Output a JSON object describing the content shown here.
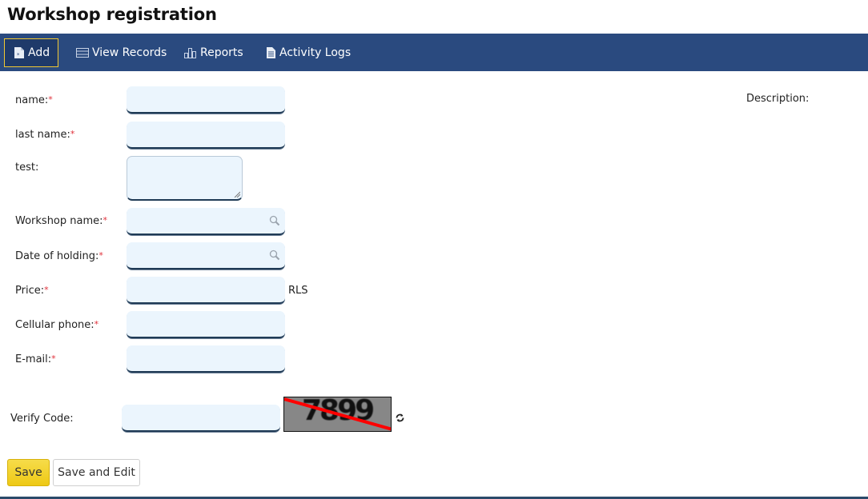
{
  "page": {
    "title": "Workshop registration"
  },
  "nav": {
    "items": [
      {
        "label": "Add",
        "icon": "new-document-icon",
        "active": true
      },
      {
        "label": "View Records",
        "icon": "list-icon",
        "active": false
      },
      {
        "label": "Reports",
        "icon": "bar-chart-icon",
        "active": false
      },
      {
        "label": "Activity Logs",
        "icon": "document-icon",
        "active": false
      }
    ]
  },
  "form": {
    "required_mark": "*",
    "fields": {
      "name": {
        "label": "name:",
        "value": ""
      },
      "last_name": {
        "label": "last name:",
        "value": ""
      },
      "test": {
        "label": "test:",
        "value": ""
      },
      "workshop_name": {
        "label": "Workshop name:",
        "value": ""
      },
      "date_of_holding": {
        "label": "Date of holding:",
        "value": ""
      },
      "price": {
        "label": "Price:",
        "value": "",
        "suffix": "RLS"
      },
      "cellular_phone": {
        "label": "Cellular phone:",
        "value": ""
      },
      "email": {
        "label": "E-mail:",
        "value": ""
      }
    },
    "description_label": "Description:",
    "verify": {
      "label": "Verify Code:",
      "value": "",
      "captcha_text": "7899"
    },
    "buttons": {
      "save": "Save",
      "save_and_edit": "Save and Edit"
    }
  },
  "colors": {
    "navbar": "#2a4a7f",
    "active_border": "#f2c832",
    "input_bg": "#ebf5fd",
    "required": "#e0303a",
    "save_button": "#eec915"
  }
}
